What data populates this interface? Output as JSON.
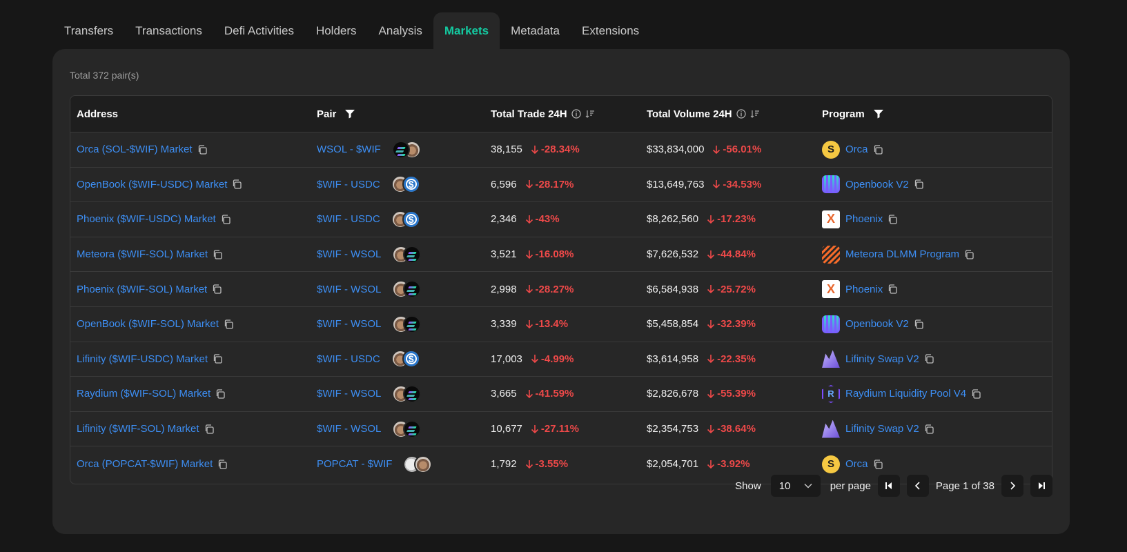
{
  "tabs": [
    {
      "label": "Transfers",
      "active": false
    },
    {
      "label": "Transactions",
      "active": false
    },
    {
      "label": "Defi Activities",
      "active": false
    },
    {
      "label": "Holders",
      "active": false
    },
    {
      "label": "Analysis",
      "active": false
    },
    {
      "label": "Markets",
      "active": true
    },
    {
      "label": "Metadata",
      "active": false
    },
    {
      "label": "Extensions",
      "active": false
    }
  ],
  "total": "Total 372 pair(s)",
  "headers": {
    "address": "Address",
    "pair": "Pair",
    "trade": "Total Trade 24H",
    "volume": "Total Volume 24H",
    "program": "Program"
  },
  "rows": [
    {
      "address": "Orca (SOL-$WIF) Market",
      "pair": "WSOL - $WIF",
      "tokens": [
        "sol",
        "dog"
      ],
      "trade": "38,155",
      "trade_change": "-28.34%",
      "volume": "$33,834,000",
      "volume_change": "-56.01%",
      "program": "Orca",
      "program_icon": "orca"
    },
    {
      "address": "OpenBook ($WIF-USDC) Market",
      "pair": "$WIF - USDC",
      "tokens": [
        "dog",
        "usdc"
      ],
      "trade": "6,596",
      "trade_change": "-28.17%",
      "volume": "$13,649,763",
      "volume_change": "-34.53%",
      "program": "Openbook V2",
      "program_icon": "openbook"
    },
    {
      "address": "Phoenix ($WIF-USDC) Market",
      "pair": "$WIF - USDC",
      "tokens": [
        "dog",
        "usdc"
      ],
      "trade": "2,346",
      "trade_change": "-43%",
      "volume": "$8,262,560",
      "volume_change": "-17.23%",
      "program": "Phoenix",
      "program_icon": "phoenix"
    },
    {
      "address": "Meteora ($WIF-SOL) Market",
      "pair": "$WIF - WSOL",
      "tokens": [
        "dog",
        "sol"
      ],
      "trade": "3,521",
      "trade_change": "-16.08%",
      "volume": "$7,626,532",
      "volume_change": "-44.84%",
      "program": "Meteora DLMM Program",
      "program_icon": "meteora"
    },
    {
      "address": "Phoenix ($WIF-SOL) Market",
      "pair": "$WIF - WSOL",
      "tokens": [
        "dog",
        "sol"
      ],
      "trade": "2,998",
      "trade_change": "-28.27%",
      "volume": "$6,584,938",
      "volume_change": "-25.72%",
      "program": "Phoenix",
      "program_icon": "phoenix"
    },
    {
      "address": "OpenBook ($WIF-SOL) Market",
      "pair": "$WIF - WSOL",
      "tokens": [
        "dog",
        "sol"
      ],
      "trade": "3,339",
      "trade_change": "-13.4%",
      "volume": "$5,458,854",
      "volume_change": "-32.39%",
      "program": "Openbook V2",
      "program_icon": "openbook"
    },
    {
      "address": "Lifinity ($WIF-USDC) Market",
      "pair": "$WIF - USDC",
      "tokens": [
        "dog",
        "usdc"
      ],
      "trade": "17,003",
      "trade_change": "-4.99%",
      "volume": "$3,614,958",
      "volume_change": "-22.35%",
      "program": "Lifinity Swap V2",
      "program_icon": "lifinity"
    },
    {
      "address": "Raydium ($WIF-SOL) Market",
      "pair": "$WIF - WSOL",
      "tokens": [
        "dog",
        "sol"
      ],
      "trade": "3,665",
      "trade_change": "-41.59%",
      "volume": "$2,826,678",
      "volume_change": "-55.39%",
      "program": "Raydium Liquidity Pool V4",
      "program_icon": "raydium"
    },
    {
      "address": "Lifinity ($WIF-SOL) Market",
      "pair": "$WIF - WSOL",
      "tokens": [
        "dog",
        "sol"
      ],
      "trade": "10,677",
      "trade_change": "-27.11%",
      "volume": "$2,354,753",
      "volume_change": "-38.64%",
      "program": "Lifinity Swap V2",
      "program_icon": "lifinity"
    },
    {
      "address": "Orca (POPCAT-$WIF) Market",
      "pair": "POPCAT - $WIF",
      "tokens": [
        "cat",
        "dog"
      ],
      "trade": "1,792",
      "trade_change": "-3.55%",
      "volume": "$2,054,701",
      "volume_change": "-3.92%",
      "program": "Orca",
      "program_icon": "orca"
    }
  ],
  "pagination": {
    "show_label": "Show",
    "per_page_value": "10",
    "per_page_label": "per page",
    "page_text": "Page 1 of 38"
  },
  "colors": {
    "accent": "#14c9a0",
    "link": "#3d8ff5",
    "negative": "#ee4949",
    "panel": "#272727",
    "background": "#171717"
  }
}
